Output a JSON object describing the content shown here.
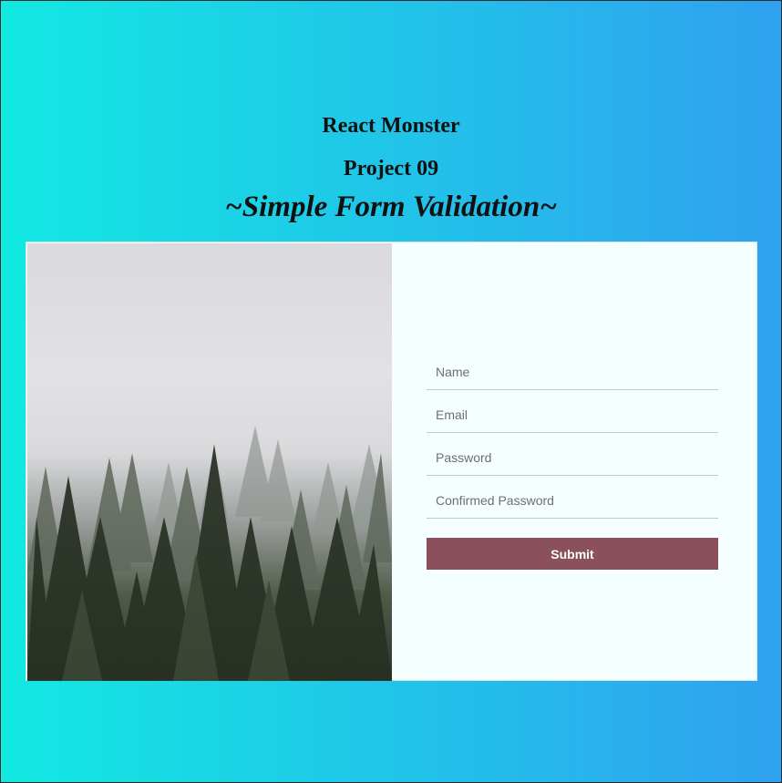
{
  "header": {
    "title": "React Monster",
    "project": "Project 09",
    "subtitle": "~Simple Form Validation~"
  },
  "form": {
    "fields": [
      {
        "placeholder": "Name",
        "value": ""
      },
      {
        "placeholder": "Email",
        "value": ""
      },
      {
        "placeholder": "Password",
        "value": ""
      },
      {
        "placeholder": "Confirmed Password",
        "value": ""
      }
    ],
    "submit_label": "Submit"
  },
  "image": {
    "description_icon": "foggy-forest-image"
  },
  "colors": {
    "background_gradient_start": "#12e9e2",
    "background_gradient_end": "#2fa1ef",
    "card_background": "#f5ffff",
    "submit_button": "#8a505c"
  }
}
